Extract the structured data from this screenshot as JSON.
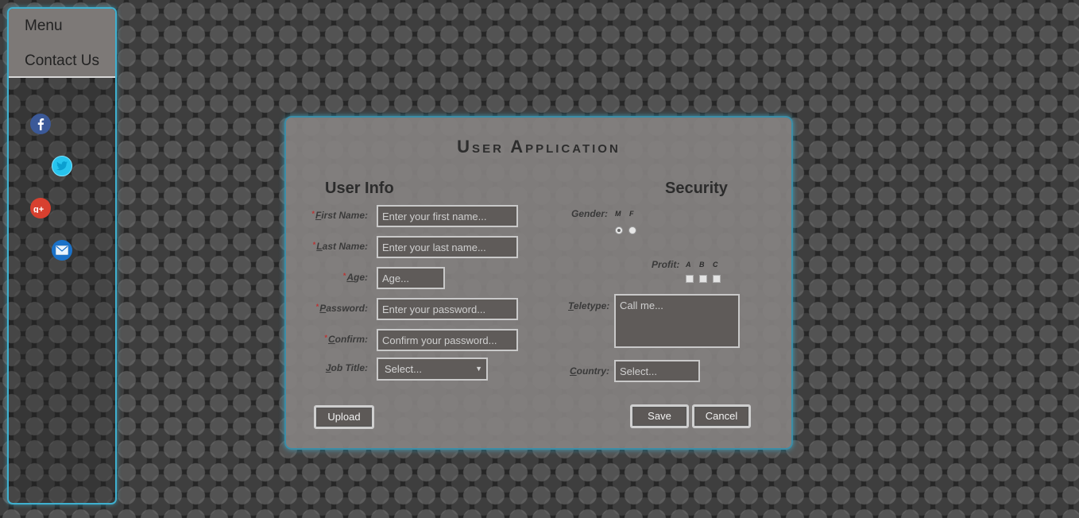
{
  "sidebar": {
    "items": [
      {
        "label": "Menu"
      },
      {
        "label": "Contact Us"
      }
    ],
    "social": [
      {
        "icon": "facebook-icon",
        "color": "#3b5998"
      },
      {
        "icon": "twitter-icon",
        "color": "#33ccff"
      },
      {
        "icon": "google-plus-icon",
        "color": "#dd4b39"
      },
      {
        "icon": "mail-icon",
        "color": "#1a7ad6"
      }
    ]
  },
  "form": {
    "title": "User Application",
    "user_info_heading": "User Info",
    "security_heading": "Security",
    "first_name": {
      "label_first": "F",
      "label_rest": "irst Name:",
      "required": "*",
      "placeholder": "Enter your first name..."
    },
    "last_name": {
      "label_first": "L",
      "label_rest": "ast Name:",
      "required": "*",
      "placeholder": "Enter your last name..."
    },
    "age": {
      "label_first": "A",
      "label_rest": "ge:",
      "required": "*",
      "placeholder": "Age..."
    },
    "password": {
      "label_first": "P",
      "label_rest": "assword:",
      "required": "*",
      "placeholder": "Enter your password..."
    },
    "confirm": {
      "label_first": "C",
      "label_rest": "onfirm:",
      "required": "*",
      "placeholder": "Confirm your password..."
    },
    "job_title": {
      "label_first": "J",
      "label_rest": "ob Title:",
      "value": "Select..."
    },
    "gender": {
      "label": "Gender:",
      "options": [
        "M",
        "F"
      ],
      "selected": "M"
    },
    "profit": {
      "label": "Profit:",
      "options": [
        "A",
        "B",
        "C"
      ]
    },
    "teletype": {
      "label_first": "T",
      "label_rest": "eletype:",
      "placeholder": "Call me..."
    },
    "country": {
      "label_first": "C",
      "label_rest": "ountry:",
      "placeholder": "Select..."
    },
    "buttons": {
      "upload": "Upload",
      "save": "Save",
      "cancel": "Cancel"
    }
  },
  "colors": {
    "accent": "#3fb0cf",
    "panel": "#848180",
    "field": "#5f5b59"
  }
}
